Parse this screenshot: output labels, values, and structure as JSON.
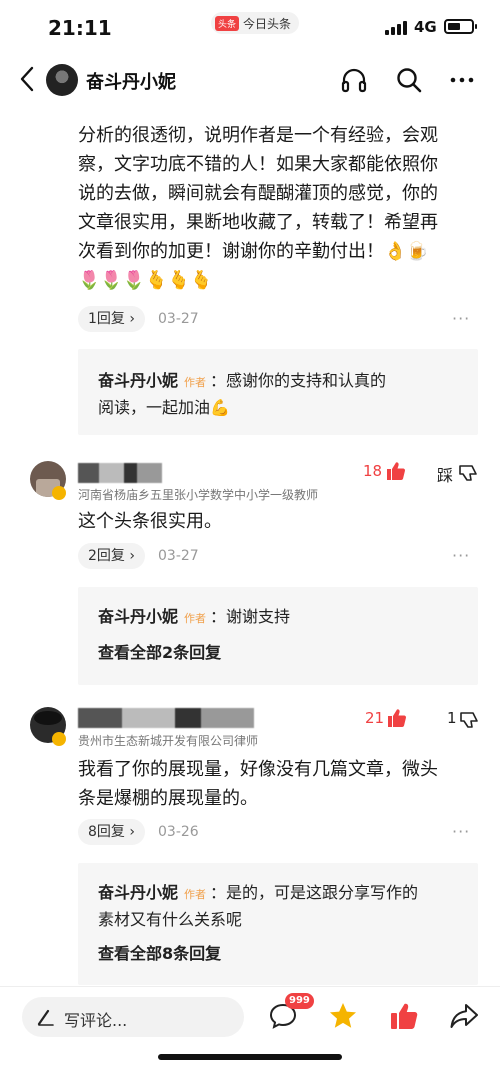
{
  "status_bar": {
    "time": "21:11",
    "app_badge": "头条",
    "app_name": "今日头条",
    "network": "4G",
    "battery_level": 0.55
  },
  "header": {
    "title": "奋斗丹小妮"
  },
  "comments": [
    {
      "lines": [
        "分析的很透彻，说明作者是一个有经验，会观",
        "察，文字功底不错的人！如果大家都能依照你",
        "说的去做，瞬间就会有醍醐灌顶的感觉，你的",
        "文章很实用，果断地收藏了，转载了！希望再",
        "次看到你的加更！谢谢你的辛勤付出！👌🍺",
        "🌷🌷🌷🫰🫰🫰"
      ],
      "reply_count": "1回复",
      "date": "03-27",
      "author_reply": {
        "author": "奋斗丹小妮",
        "tag": "作者",
        "line1": "：感谢你的支持和认真的",
        "line2": "阅读，一起加油💪"
      }
    },
    {
      "subtitle": "河南省杨庙乡五里张小学数学中小学一级教师",
      "likes": "18",
      "dislike": "踩",
      "text": "这个头条很实用。",
      "reply_count": "2回复",
      "date": "03-27",
      "author_reply": {
        "author": "奋斗丹小妮",
        "tag": "作者",
        "line1": "：谢谢支持"
      },
      "view_all": "查看全部2条回复"
    },
    {
      "subtitle": "贵州市生态新城开发有限公司律师",
      "likes": "21",
      "dislikes": "1",
      "lines": [
        "我看了你的展现量，好像没有几篇文章，微头",
        "条是爆棚的展现量的。"
      ],
      "reply_count": "8回复",
      "date": "03-26",
      "author_reply": {
        "author": "奋斗丹小妮",
        "tag": "作者",
        "line1": "：是的，可是这跟分享写作的",
        "line2": "素材又有什么关系呢"
      },
      "view_all": "查看全部8条回复"
    }
  ],
  "bottom_bar": {
    "write_placeholder": "写评论...",
    "comment_badge": "999"
  },
  "colors": {
    "accent_red": "#f04142",
    "author_tag": "#f0a04b",
    "star": "#f5b400"
  },
  "icons": [
    "back-icon",
    "headphones-icon",
    "search-icon",
    "more-icon",
    "thumbs-up-icon",
    "thumbs-down-icon",
    "pen-icon",
    "comment-icon",
    "star-icon",
    "share-icon"
  ]
}
